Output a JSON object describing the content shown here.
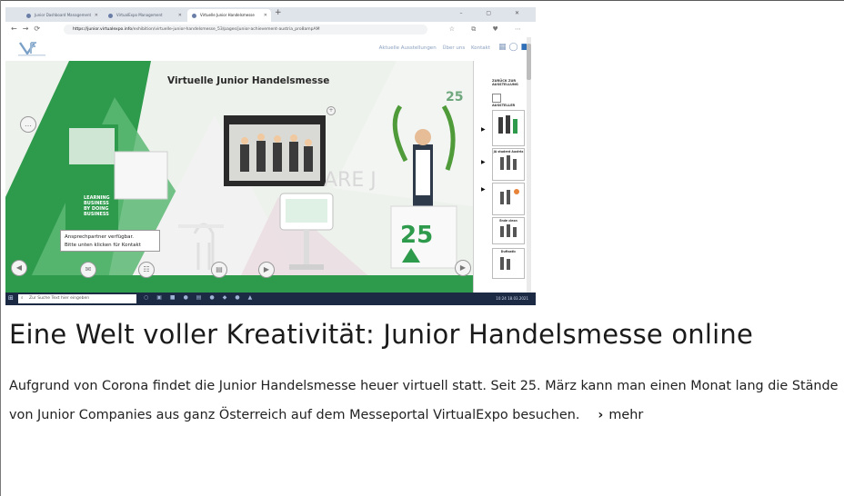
{
  "screenshot": {
    "browser": {
      "tabs": [
        {
          "label": "Junior Dashboard Management"
        },
        {
          "label": "VirtualExpo Management"
        },
        {
          "label": "Virtuelle Junior Handelsmesse"
        }
      ],
      "url_host": "https://junior.virtualexpo.info",
      "url_path": "/exhibition/virtuelle-junior-handelsmesse_53/pages/junior-achievement-austria_pro8ampAM"
    },
    "site_nav": {
      "links": [
        "Aktuelle Ausstellungen",
        "Über uns",
        "Kontakt"
      ]
    },
    "stage": {
      "title": "Virtuelle Junior Handelsmesse",
      "contact_lines": [
        "Ansprechpartner verfügbar.",
        "Bitte unten klicken für Kontakt"
      ],
      "banner_lines": [
        "LEARNING",
        "BUSINESS",
        "BY DOING",
        "BUSINESS"
      ]
    },
    "right_panel": {
      "back_label": "ZURÜCK ZUR AUSSTELLUNG",
      "exhibitors_label": "AUSSTELLER",
      "cards": [
        {
          "label": ""
        },
        {
          "label": "JA student Austria"
        },
        {
          "label": ""
        },
        {
          "label": "Ende clean"
        },
        {
          "label": "Duftastic"
        }
      ]
    },
    "taskbar": {
      "search_placeholder": "Zur Suche Text hier eingeben",
      "time": "10:24",
      "date": "18.03.2021"
    },
    "colors": {
      "brand_green": "#2e9a4c",
      "taskbar": "#1c2a44"
    }
  },
  "article": {
    "headline": "Eine Welt voller Kreativität: Junior Handelsmesse online",
    "teaser": "Aufgrund von Corona findet die Junior Handelsmesse heuer virtuell statt. Seit 25. März kann man einen Monat lang die Stände von Junior Companies aus ganz Österreich auf dem Messeportal VirtualExpo besuchen.",
    "more_label": "mehr"
  }
}
